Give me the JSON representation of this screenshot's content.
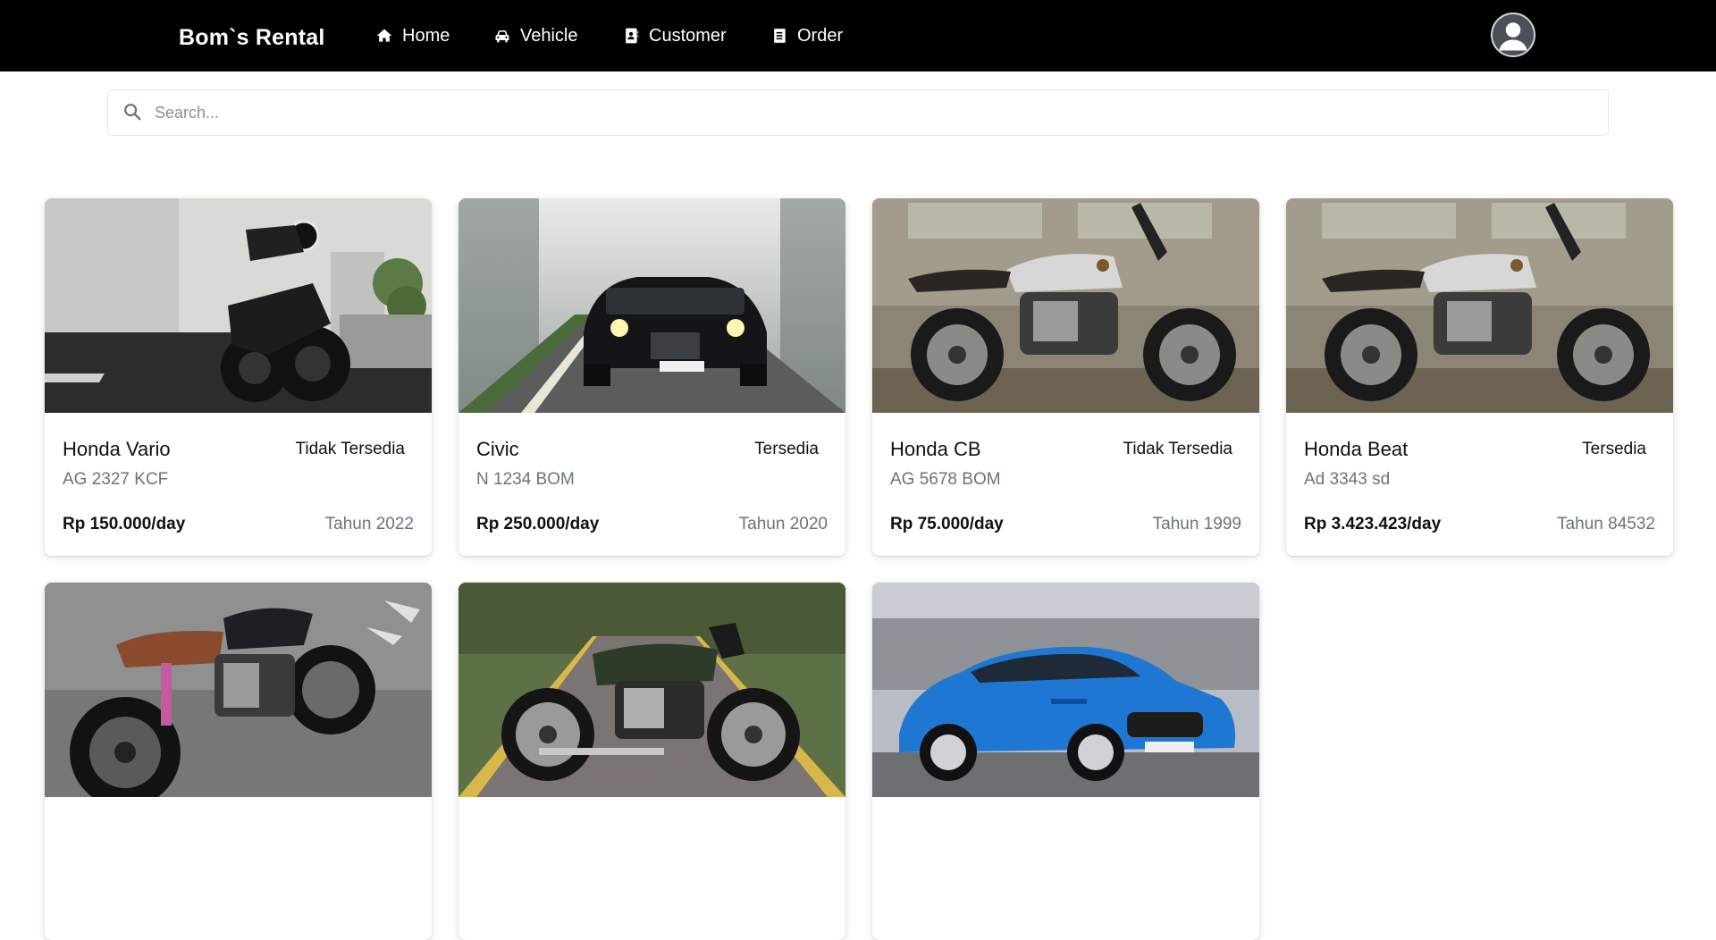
{
  "navbar": {
    "brand": "Bom`s Rental",
    "items": [
      {
        "label": "Home",
        "icon": "home-icon"
      },
      {
        "label": "Vehicle",
        "icon": "car-icon"
      },
      {
        "label": "Customer",
        "icon": "address-book-icon"
      },
      {
        "label": "Order",
        "icon": "receipt-icon"
      }
    ],
    "avatar_icon": "user-avatar-icon"
  },
  "search": {
    "placeholder": "Search...",
    "value": "",
    "icon": "search-icon"
  },
  "vehicles": [
    {
      "name": "Honda Vario",
      "status": "Tidak Tersedia",
      "plate": "AG 2327 KCF",
      "price": "Rp 150.000/day",
      "year": "Tahun 2022",
      "image": "dark cafe racer motorcycle in garage"
    },
    {
      "name": "Civic",
      "status": "Tersedia",
      "plate": "N 1234 BOM",
      "price": "Rp 250.000/day",
      "year": "Tahun 2020",
      "image": "black SUV on foggy forest road"
    },
    {
      "name": "Honda CB",
      "status": "Tidak Tersedia",
      "plate": "AG 5678 BOM",
      "price": "Rp 75.000/day",
      "year": "Tahun 1999",
      "image": "silver tank motorcycle against wall"
    },
    {
      "name": "Honda Beat",
      "status": "Tersedia",
      "plate": "Ad 3343 sd",
      "price": "Rp 3.423.423/day",
      "year": "Tahun 84532",
      "image": "silver tank motorcycle against wall"
    },
    {
      "image": "black motorcycle with brown seat on pavement"
    },
    {
      "image": "green cafe racer motorcycle on road"
    },
    {
      "image": "blue hatchback car"
    }
  ]
}
